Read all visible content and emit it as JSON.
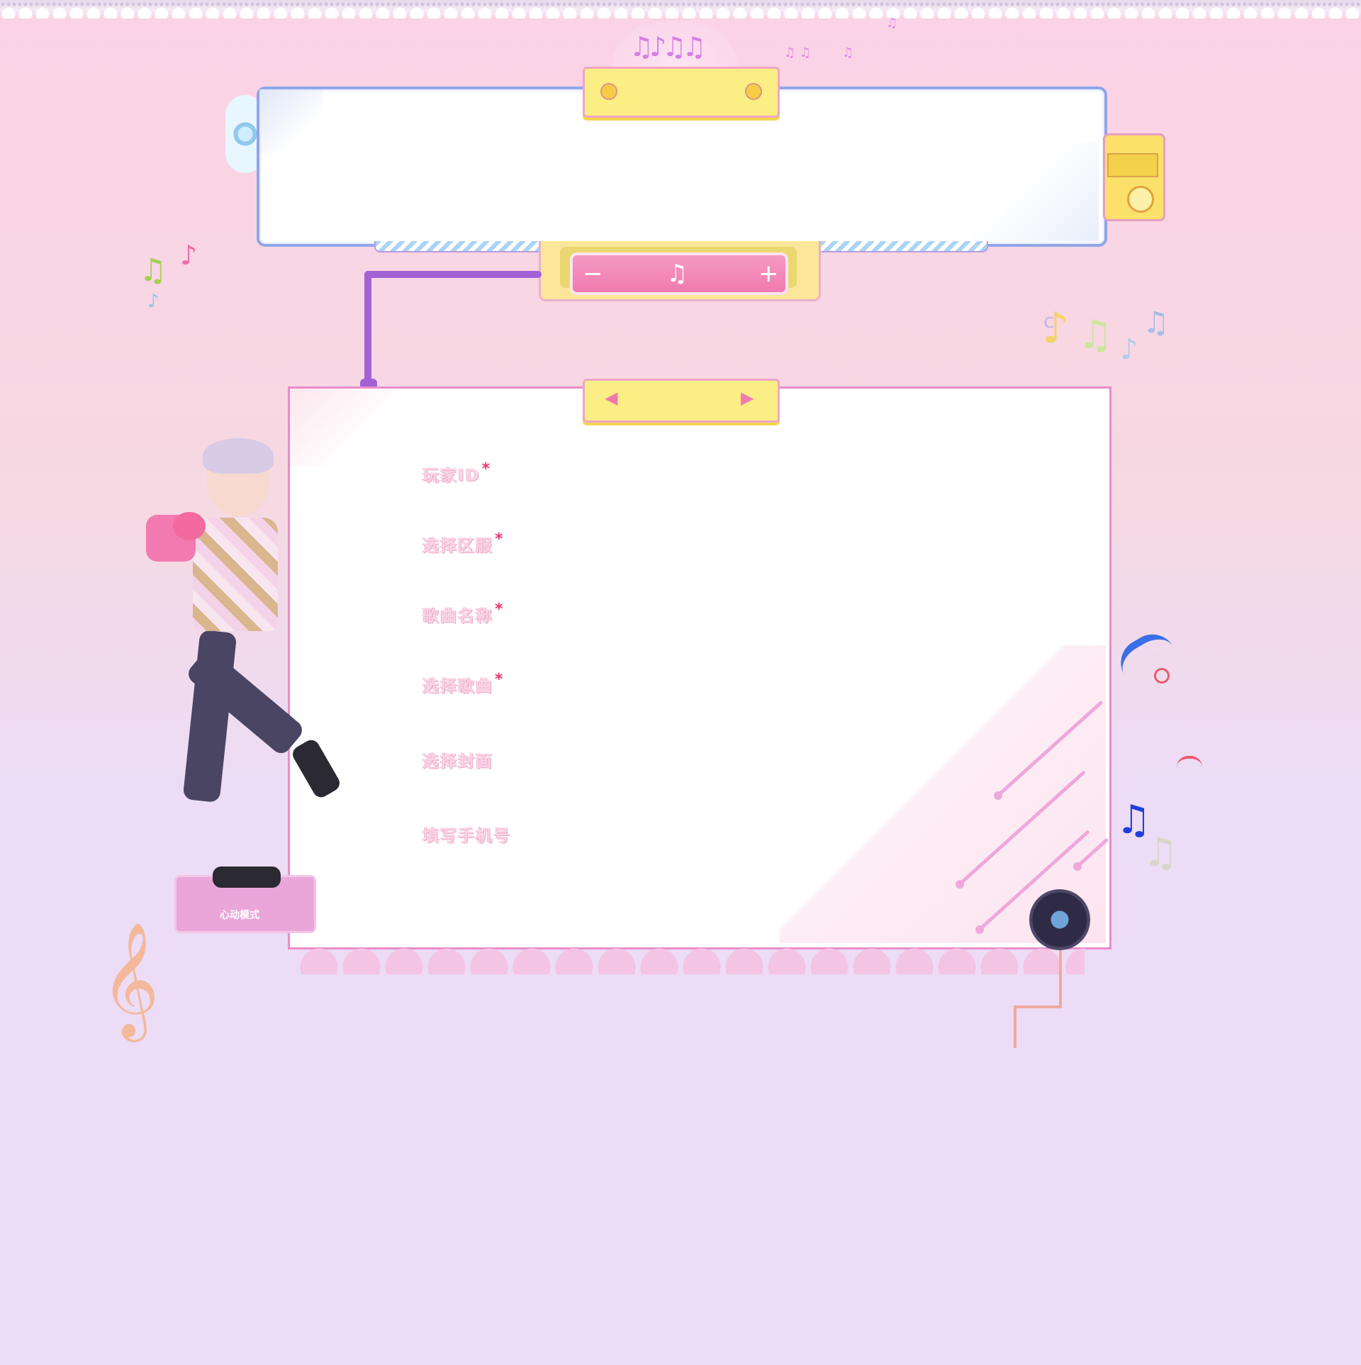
{
  "form": {
    "fields": [
      {
        "label": "玩家ID",
        "required": true
      },
      {
        "label": "选择区服",
        "required": true
      },
      {
        "label": "歌曲名称",
        "required": true
      },
      {
        "label": "选择歌曲",
        "required": true
      },
      {
        "label": "选择封面",
        "required": false
      },
      {
        "label": "填写手机号",
        "required": false
      }
    ],
    "required_mark": "*"
  },
  "volume": {
    "minus": "−",
    "note": "♫",
    "plus": "+"
  },
  "pedestal": {
    "label": "心动模式"
  },
  "icons": {
    "top_tab_left": "disc-icon",
    "top_tab_right": "disc-icon",
    "main_tab_left": "megaphone-icon",
    "main_tab_right": "megaphone-icon"
  },
  "colors": {
    "accent_pink": "#f07aaf",
    "tab_yellow": "#fbee84",
    "panel_border": "#e98ccb",
    "required_red": "#e8396b"
  }
}
